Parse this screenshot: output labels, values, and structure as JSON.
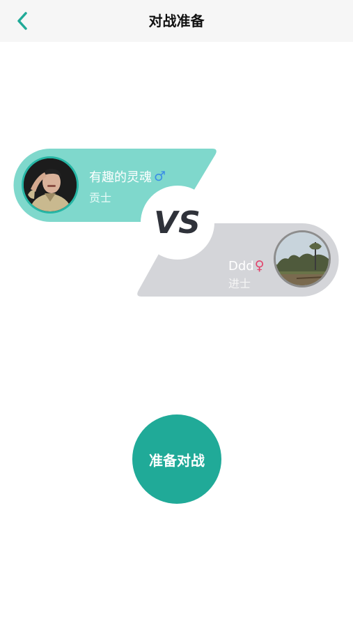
{
  "header": {
    "title": "对战准备"
  },
  "icons": {
    "back": "chevron-left-icon",
    "male": "male-gender-icon",
    "female": "female-gender-icon"
  },
  "colors": {
    "accent": "#20aa98",
    "player1_panel": "#7fd8cc",
    "player2_panel": "#d4d5d9",
    "male_symbol": "#3a8ee6",
    "female_symbol": "#e2456d"
  },
  "player1": {
    "name": "有趣的灵魂",
    "gender_symbol": "♂",
    "rank": "贡士"
  },
  "player2": {
    "name": "Ddd",
    "gender_symbol": "♀",
    "rank": "进士"
  },
  "versus": {
    "label": "VS"
  },
  "actions": {
    "ready_label": "准备对战"
  }
}
